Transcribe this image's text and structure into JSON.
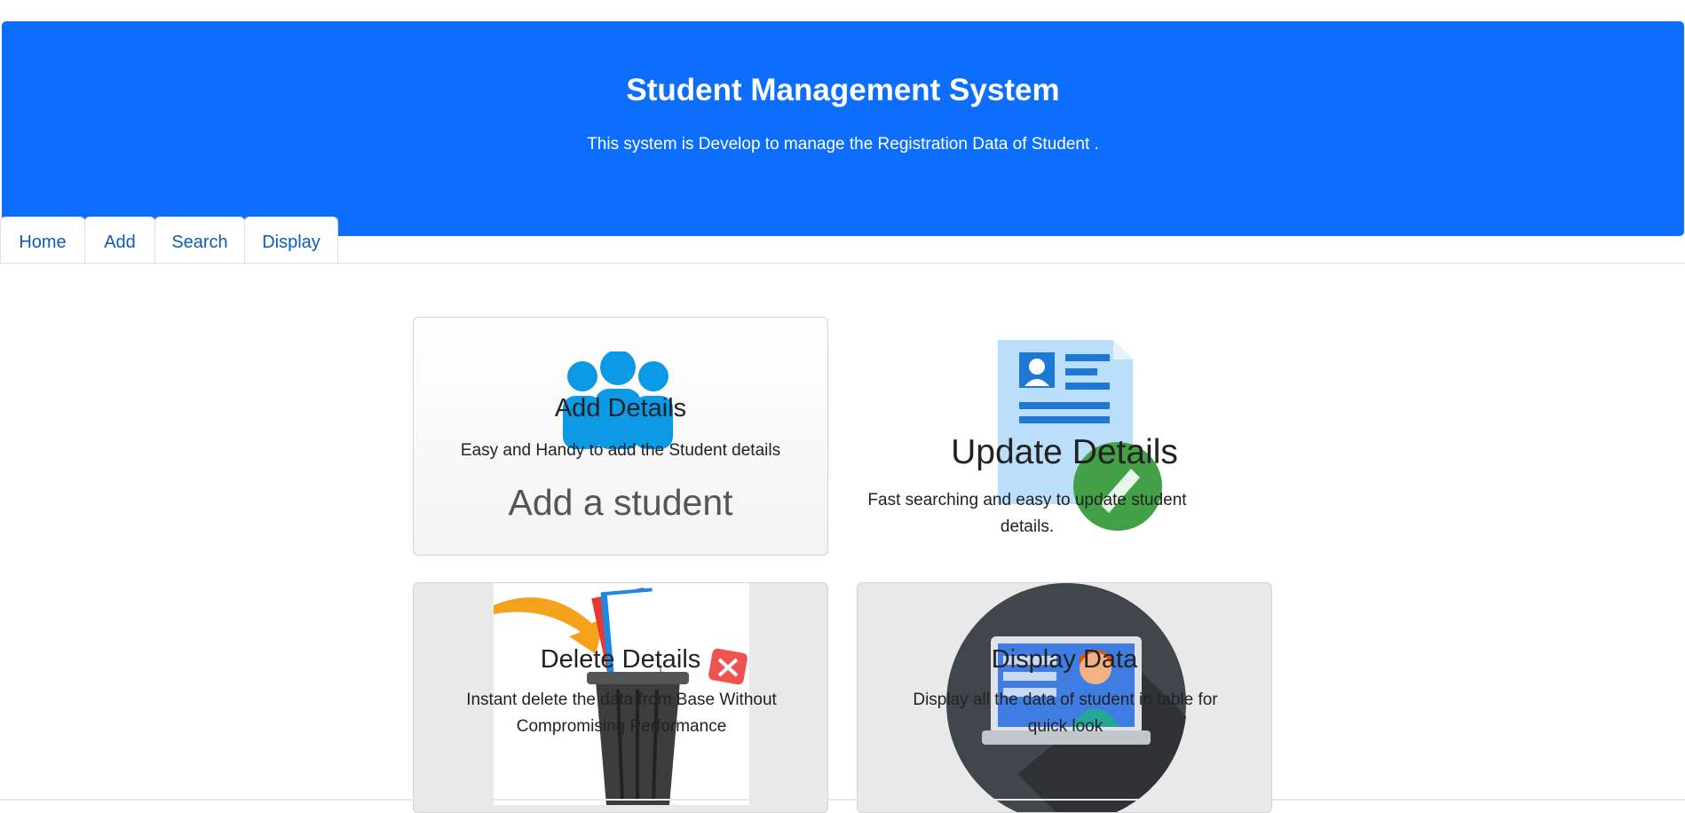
{
  "header": {
    "title": "Student Management System",
    "subtitle": "This system is Develop to manage the Registration Data of Student ."
  },
  "tabs": [
    {
      "label": "Home"
    },
    {
      "label": "Add"
    },
    {
      "label": "Search"
    },
    {
      "label": "Display"
    }
  ],
  "cards": {
    "add": {
      "title": "Add Details",
      "desc": "Easy and Handy to add the Student details",
      "image_text": "Add a student"
    },
    "update": {
      "title": "Update Details",
      "desc": "Fast searching and easy to update student details."
    },
    "delete": {
      "title": "Delete Details",
      "desc": "Instant delete the data from Base Without Compromising Performance"
    },
    "display": {
      "title": "Display Data",
      "desc": "Display all the data of student in table for quick look"
    }
  },
  "colors": {
    "primary": "#0d6efd",
    "link": "#0d5cb8"
  }
}
